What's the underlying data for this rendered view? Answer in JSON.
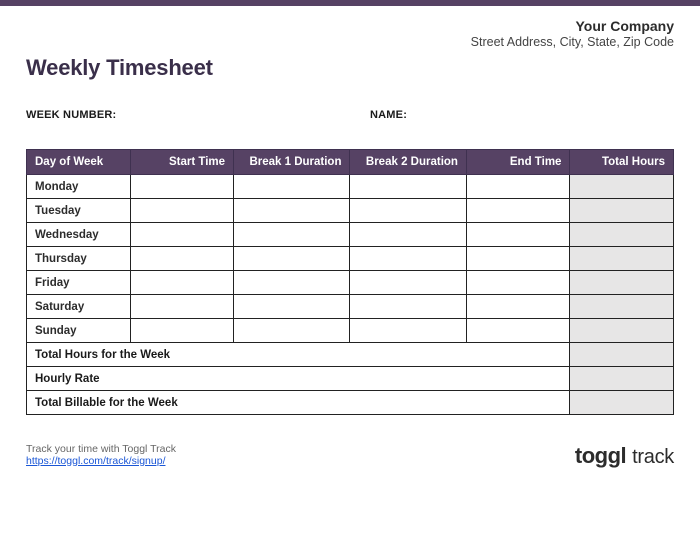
{
  "company": {
    "name": "Your Company",
    "address": "Street Address, City, State, Zip Code"
  },
  "title": "Weekly Timesheet",
  "meta": {
    "week_number_label": "WEEK NUMBER:",
    "week_number_value": "",
    "name_label": "NAME:",
    "name_value": ""
  },
  "table": {
    "headers": {
      "day": "Day of Week",
      "start": "Start Time",
      "break1": "Break 1 Duration",
      "break2": "Break 2 Duration",
      "end": "End Time",
      "total": "Total Hours"
    },
    "rows": [
      {
        "day": "Monday",
        "start": "",
        "break1": "",
        "break2": "",
        "end": "",
        "total": ""
      },
      {
        "day": "Tuesday",
        "start": "",
        "break1": "",
        "break2": "",
        "end": "",
        "total": ""
      },
      {
        "day": "Wednesday",
        "start": "",
        "break1": "",
        "break2": "",
        "end": "",
        "total": ""
      },
      {
        "day": "Thursday",
        "start": "",
        "break1": "",
        "break2": "",
        "end": "",
        "total": ""
      },
      {
        "day": "Friday",
        "start": "",
        "break1": "",
        "break2": "",
        "end": "",
        "total": ""
      },
      {
        "day": "Saturday",
        "start": "",
        "break1": "",
        "break2": "",
        "end": "",
        "total": ""
      },
      {
        "day": "Sunday",
        "start": "",
        "break1": "",
        "break2": "",
        "end": "",
        "total": ""
      }
    ],
    "summary": {
      "total_hours_label": "Total Hours for the Week",
      "total_hours_value": "",
      "hourly_rate_label": "Hourly Rate",
      "hourly_rate_value": "",
      "total_billable_label": "Total Billable for the Week",
      "total_billable_value": ""
    }
  },
  "footer": {
    "tagline": "Track your time with Toggl Track",
    "link_text": "https://toggl.com/track/signup/",
    "logo_word1": "toggl",
    "logo_word2": "track"
  }
}
